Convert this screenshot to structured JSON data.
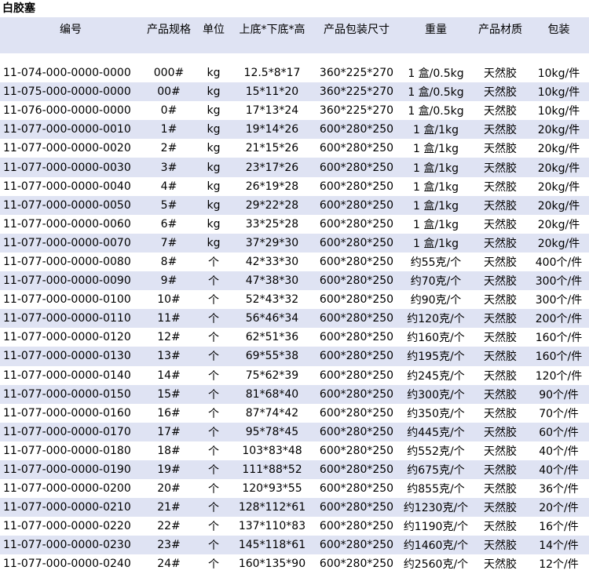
{
  "title": "白胶塞",
  "headers": [
    "编号",
    "产品规格",
    "单位",
    "上底*下底*高",
    "产品包装尺寸",
    "重量",
    "产品材质",
    "包装"
  ],
  "rows": [
    [
      "11-074-000-0000-0000",
      "000#",
      "kg",
      "12.5*8*17",
      "360*225*270",
      "1 盒/0.5kg",
      "天然胶",
      "10kg/件"
    ],
    [
      "11-075-000-0000-0000",
      "00#",
      "kg",
      "15*11*20",
      "360*225*270",
      "1 盒/0.5kg",
      "天然胶",
      "10kg/件"
    ],
    [
      "11-076-000-0000-0000",
      "0#",
      "kg",
      "17*13*24",
      "360*225*270",
      "1 盒/0.5kg",
      "天然胶",
      "10kg/件"
    ],
    [
      "11-077-000-0000-0010",
      "1#",
      "kg",
      "19*14*26",
      "600*280*250",
      "1 盒/1kg",
      "天然胶",
      "20kg/件"
    ],
    [
      "11-077-000-0000-0020",
      "2#",
      "kg",
      "21*15*26",
      "600*280*250",
      "1 盒/1kg",
      "天然胶",
      "20kg/件"
    ],
    [
      "11-077-000-0000-0030",
      "3#",
      "kg",
      "23*17*26",
      "600*280*250",
      "1 盒/1kg",
      "天然胶",
      "20kg/件"
    ],
    [
      "11-077-000-0000-0040",
      "4#",
      "kg",
      "26*19*28",
      "600*280*250",
      "1 盒/1kg",
      "天然胶",
      "20kg/件"
    ],
    [
      "11-077-000-0000-0050",
      "5#",
      "kg",
      "29*22*28",
      "600*280*250",
      "1 盒/1kg",
      "天然胶",
      "20kg/件"
    ],
    [
      "11-077-000-0000-0060",
      "6#",
      "kg",
      "33*25*28",
      "600*280*250",
      "1 盒/1kg",
      "天然胶",
      "20kg/件"
    ],
    [
      "11-077-000-0000-0070",
      "7#",
      "kg",
      "37*29*30",
      "600*280*250",
      "1 盒/1kg",
      "天然胶",
      "20kg/件"
    ],
    [
      "11-077-000-0000-0080",
      "8#",
      "个",
      "42*33*30",
      "600*280*250",
      "约55克/个",
      "天然胶",
      "400个/件"
    ],
    [
      "11-077-000-0000-0090",
      "9#",
      "个",
      "47*38*30",
      "600*280*250",
      "约70克/个",
      "天然胶",
      "300个/件"
    ],
    [
      "11-077-000-0000-0100",
      "10#",
      "个",
      "52*43*32",
      "600*280*250",
      "约90克/个",
      "天然胶",
      "300个/件"
    ],
    [
      "11-077-000-0000-0110",
      "11#",
      "个",
      "56*46*34",
      "600*280*250",
      "约120克/个",
      "天然胶",
      "200个/件"
    ],
    [
      "11-077-000-0000-0120",
      "12#",
      "个",
      "62*51*36",
      "600*280*250",
      "约160克/个",
      "天然胶",
      "160个/件"
    ],
    [
      "11-077-000-0000-0130",
      "13#",
      "个",
      "69*55*38",
      "600*280*250",
      "约195克/个",
      "天然胶",
      "160个/件"
    ],
    [
      "11-077-000-0000-0140",
      "14#",
      "个",
      "75*62*39",
      "600*280*250",
      "约245克/个",
      "天然胶",
      "120个/件"
    ],
    [
      "11-077-000-0000-0150",
      "15#",
      "个",
      "81*68*40",
      "600*280*250",
      "约300克/个",
      "天然胶",
      "90个/件"
    ],
    [
      "11-077-000-0000-0160",
      "16#",
      "个",
      "87*74*42",
      "600*280*250",
      "约350克/个",
      "天然胶",
      "70个/件"
    ],
    [
      "11-077-000-0000-0170",
      "17#",
      "个",
      "95*78*45",
      "600*280*250",
      "约445克/个",
      "天然胶",
      "60个/件"
    ],
    [
      "11-077-000-0000-0180",
      "18#",
      "个",
      "103*83*48",
      "600*280*250",
      "约552克/个",
      "天然胶",
      "40个/件"
    ],
    [
      "11-077-000-0000-0190",
      "19#",
      "个",
      "111*88*52",
      "600*280*250",
      "约675克/个",
      "天然胶",
      "40个/件"
    ],
    [
      "11-077-000-0000-0200",
      "20#",
      "个",
      "120*93*55",
      "600*280*250",
      "约855克/个",
      "天然胶",
      "36个/件"
    ],
    [
      "11-077-000-0000-0210",
      "21#",
      "个",
      "128*112*61",
      "600*280*250",
      "约1230克/个",
      "天然胶",
      "20个/件"
    ],
    [
      "11-077-000-0000-0220",
      "22#",
      "个",
      "137*110*83",
      "600*280*250",
      "约1190克/个",
      "天然胶",
      "16个/件"
    ],
    [
      "11-077-000-0000-0230",
      "23#",
      "个",
      "145*118*61",
      "600*280*250",
      "约1460克/个",
      "天然胶",
      "14个/件"
    ],
    [
      "11-077-000-0000-0240",
      "24#",
      "个",
      "160*135*90",
      "600*280*250",
      "约2560克/个",
      "天然胶",
      "12个/件"
    ]
  ],
  "colors": {
    "stripe": "#dfe3f3",
    "background": "#ffffff",
    "text": "#000000"
  }
}
